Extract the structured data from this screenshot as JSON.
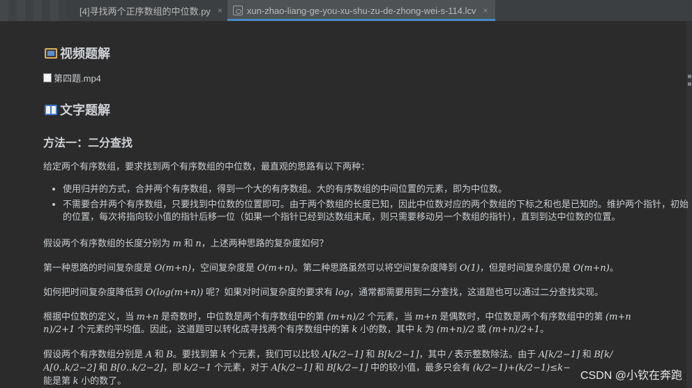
{
  "tabs": [
    {
      "label": "[4]寻找两个正序数组的中位数.py",
      "close": "×",
      "icon": "python-file-icon"
    },
    {
      "label": "xun-zhao-liang-ge-you-xu-shu-zu-de-zhong-wei-s-114.lcv",
      "close": "×",
      "icon": "lcv-file-icon"
    }
  ],
  "doc": {
    "video_heading": "视频题解",
    "video_file": "第四题.mp4",
    "text_heading": "文字题解",
    "method_title": "方法一：二分查找",
    "intro": "给定两个有序数组，要求找到两个有序数组的中位数，最直观的思路有以下两种：",
    "bullets": [
      "使用归并的方式，合并两个有序数组，得到一个大的有序数组。大的有序数组的中间位置的元素，即为中位数。",
      "不需要合并两个有序数组，只要找到中位数的位置即可。由于两个数组的长度已知，因此中位数对应的两个数组的下标之和也是已知的。维护两个指针，初始",
      "的位置，每次将指向较小值的指针后移一位（如果一个指针已经到达数组末尾，则只需要移动另一个数组的指针），直到到达中位数的位置。"
    ],
    "p1": [
      "假设两个有序数组的长度分别为",
      "m",
      "和",
      "n",
      "，上述两种思路的复杂度如何？"
    ],
    "p2": [
      "第一种思路的时间复杂度是",
      "O(m+n)",
      "，空间复杂度是",
      "O(m+n)",
      "。第二种思路虽然可以将空间复杂度降到",
      "O(1)",
      "，但是时间复杂度仍是",
      "O(m+n)",
      "。"
    ],
    "p3": [
      "如何把时间复杂度降低到",
      "O(log(m+n))",
      "呢？如果对时间复杂度的要求有",
      "log",
      "，通常都需要用到二分查找，这道题也可以通过二分查找实现。"
    ],
    "p4a": [
      "根据中位数的定义，当",
      "m+n",
      "是奇数时，中位数是两个有序数组中的第",
      "(m+n)/2",
      "个元素，当",
      "m+n",
      "是偶数时，中位数是两个有序数组中的第",
      "(m+n"
    ],
    "p4b": [
      "n)/2+1",
      "个元素的平均值。因此，这道题可以转化成寻找两个有序数组中的第",
      "k",
      "小的数，其中",
      "k",
      "为",
      "(m+n)/2",
      "或",
      "(m+n)/2+1",
      "。"
    ],
    "p5a": [
      "假设两个有序数组分别是",
      "A",
      "和",
      "B",
      "。要找到第",
      "k",
      "个元素，我们可以比较",
      "A[k/2−1]",
      "和",
      "B[k/2−1]",
      "，其中",
      "/",
      "表示整数除法。由于",
      "A[k/2−1]",
      "和",
      "B[k/"
    ],
    "p5b": [
      "A[0..k/2−2]",
      "和",
      "B[0..k/2−2]",
      "，即",
      "k/2−1",
      "个元素，对于",
      "A[k/2−1]",
      "和",
      "B[k/2−1]",
      "中的较小值，最多只会有",
      "(k/2−1)+(k/2−1)≤k−"
    ],
    "p5c": [
      "能是第",
      "k",
      "小的数了。"
    ]
  },
  "watermark": "CSDN @小钦在奔跑"
}
